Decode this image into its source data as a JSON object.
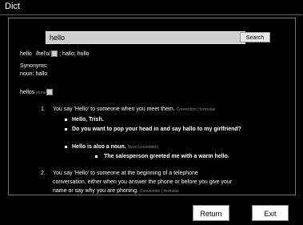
{
  "window": {
    "title": "Dict"
  },
  "search": {
    "value": "hello",
    "button_label": "Search"
  },
  "headword": {
    "word": "hello",
    "pronunciation": "/hel'o/",
    "variants": "; hallo; hullo"
  },
  "synonyms": {
    "heading": "Synonyms:",
    "line": "noun: hallo"
  },
  "plural": {
    "word": "hellos",
    "label": "plural"
  },
  "senses": [
    {
      "number": "1.",
      "text": "You say 'Hello' to someone when you meet them.",
      "tags": "Convention | formulae",
      "examples": [
        "Hello, Trish.",
        "Do you want to pop your head in and say hallo to my girlfriend?"
      ],
      "subsense": {
        "text": "Hello is also a noun.",
        "tag": "Noun (countable)",
        "example": "The salesperson greeted me with a warm hello."
      }
    },
    {
      "number": "2.",
      "lines": [
        "You say 'Hello' to someone at the beginning of a telephone",
        "conversation, either when you answer the phone or before you give your",
        "name or say why you are phoning."
      ],
      "tags": "Convention | formulae"
    }
  ],
  "buttons": {
    "return_label": "Return",
    "exit_label": "Exit"
  }
}
